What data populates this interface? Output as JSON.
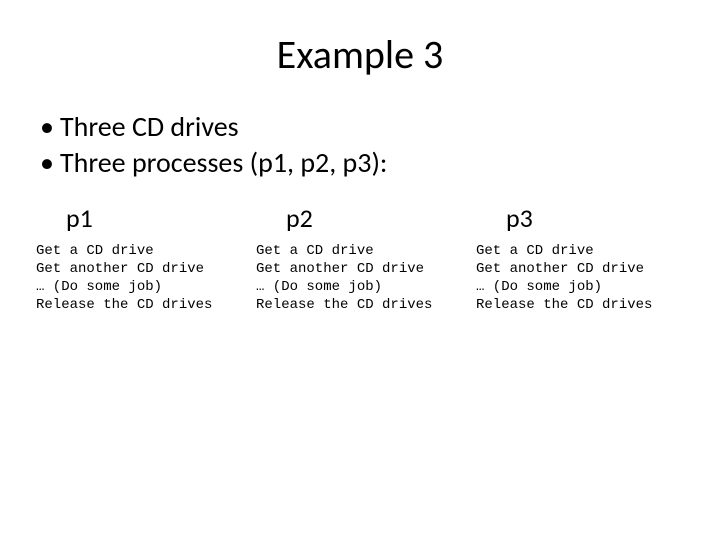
{
  "title": "Example 3",
  "bullets": {
    "item1": "Three CD drives",
    "item2": "Three processes (p1, p2, p3):"
  },
  "columns": {
    "c1": {
      "head": "p1",
      "l1": "Get a CD drive",
      "l2": "Get another CD drive",
      "l3": "… (Do some job)",
      "l4": "Release the CD drives"
    },
    "c2": {
      "head": "p2",
      "l1": "Get a CD drive",
      "l2": "Get another CD drive",
      "l3": "… (Do some job)",
      "l4": "Release the CD drives"
    },
    "c3": {
      "head": "p3",
      "l1": "Get a CD drive",
      "l2": "Get another CD drive",
      "l3": "… (Do some job)",
      "l4": "Release the CD drives"
    }
  }
}
